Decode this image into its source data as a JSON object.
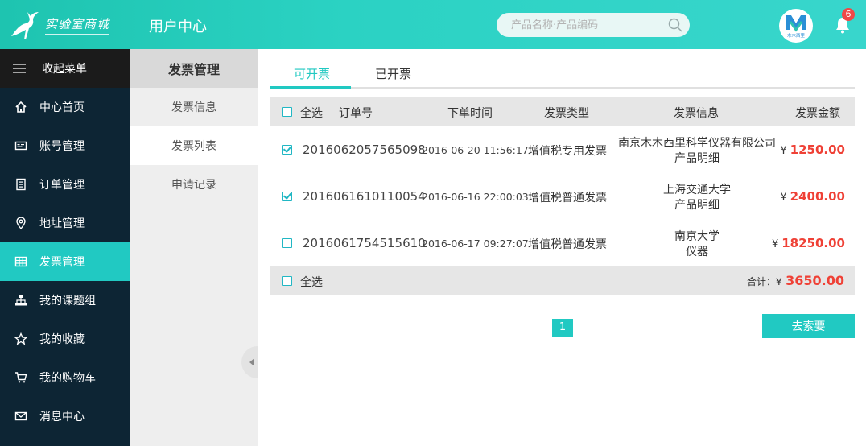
{
  "header": {
    "logo_text": "实验室商城",
    "title": "用户中心",
    "search_placeholder": "产品名称·产品编码",
    "notification_count": "6",
    "avatar_text": "木木西里"
  },
  "sidebar": {
    "collapse_label": "收起菜单",
    "items": [
      {
        "label": "中心首页",
        "icon": "home-icon"
      },
      {
        "label": "账号管理",
        "icon": "id-card-icon"
      },
      {
        "label": "订单管理",
        "icon": "document-icon"
      },
      {
        "label": "地址管理",
        "icon": "location-pin-icon"
      },
      {
        "label": "发票管理",
        "icon": "grid-icon"
      },
      {
        "label": "我的课题组",
        "icon": "org-chart-icon"
      },
      {
        "label": "我的收藏",
        "icon": "star-icon"
      },
      {
        "label": "我的购物车",
        "icon": "cart-icon"
      },
      {
        "label": "消息中心",
        "icon": "mail-icon"
      }
    ],
    "active_index": 4
  },
  "subnav": {
    "title": "发票管理",
    "items": [
      "发票信息",
      "发票列表",
      "申请记录"
    ],
    "active_index": 1
  },
  "tabs": [
    "可开票",
    "已开票"
  ],
  "table": {
    "select_all": "全选",
    "columns": [
      "订单号",
      "下单时间",
      "发票类型",
      "发票信息",
      "发票金额"
    ],
    "currency": "¥",
    "rows": [
      {
        "checked": true,
        "order_no": "2016062057565098",
        "time": "2016-06-20 11:56:17",
        "type": "增值税专用发票",
        "info1": "南京木木西里科学仪器有限公司",
        "info2": "产品明细",
        "amount": "1250.00"
      },
      {
        "checked": true,
        "order_no": "2016061610110054",
        "time": "2016-06-16 22:00:03",
        "type": "增值税普通发票",
        "info1": "上海交通大学",
        "info2": "产品明细",
        "amount": "2400.00"
      },
      {
        "checked": false,
        "order_no": "2016061754515610",
        "time": "2016-06-17 09:27:07",
        "type": "增值税普通发票",
        "info1": "南京大学",
        "info2": "仪器",
        "amount": "18250.00"
      }
    ],
    "footer_select_all": "全选",
    "total_label": "合计：¥",
    "total_value": "3650.00"
  },
  "pagination": {
    "current": "1"
  },
  "claim_button": "去索要",
  "colors": {
    "accent": "#21c9c2",
    "sidebar_bg": "#0d2534",
    "amount": "#ef4136"
  }
}
